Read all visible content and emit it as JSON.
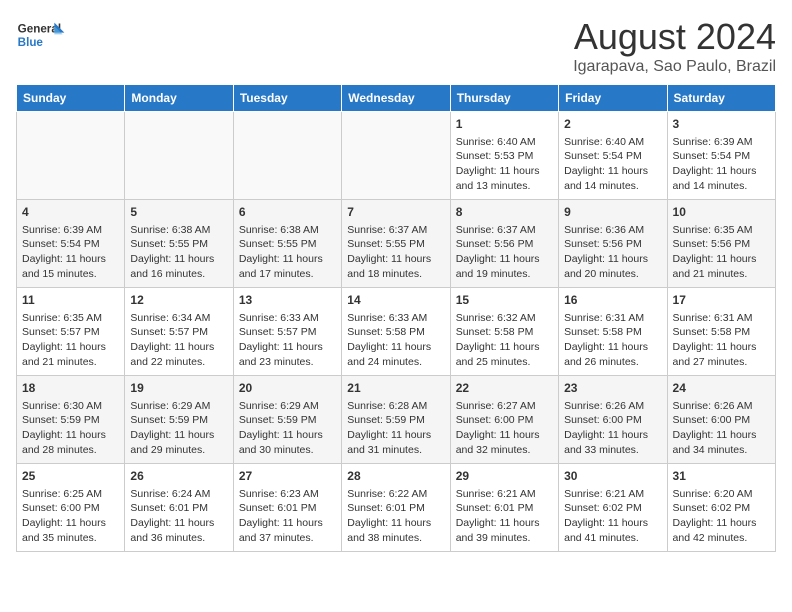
{
  "header": {
    "logo_line1": "General",
    "logo_line2": "Blue",
    "month_year": "August 2024",
    "location": "Igarapava, Sao Paulo, Brazil"
  },
  "columns": [
    "Sunday",
    "Monday",
    "Tuesday",
    "Wednesday",
    "Thursday",
    "Friday",
    "Saturday"
  ],
  "weeks": [
    [
      {
        "day": "",
        "info": ""
      },
      {
        "day": "",
        "info": ""
      },
      {
        "day": "",
        "info": ""
      },
      {
        "day": "",
        "info": ""
      },
      {
        "day": "1",
        "info": "Sunrise: 6:40 AM\nSunset: 5:53 PM\nDaylight: 11 hours and 13 minutes."
      },
      {
        "day": "2",
        "info": "Sunrise: 6:40 AM\nSunset: 5:54 PM\nDaylight: 11 hours and 14 minutes."
      },
      {
        "day": "3",
        "info": "Sunrise: 6:39 AM\nSunset: 5:54 PM\nDaylight: 11 hours and 14 minutes."
      }
    ],
    [
      {
        "day": "4",
        "info": "Sunrise: 6:39 AM\nSunset: 5:54 PM\nDaylight: 11 hours and 15 minutes."
      },
      {
        "day": "5",
        "info": "Sunrise: 6:38 AM\nSunset: 5:55 PM\nDaylight: 11 hours and 16 minutes."
      },
      {
        "day": "6",
        "info": "Sunrise: 6:38 AM\nSunset: 5:55 PM\nDaylight: 11 hours and 17 minutes."
      },
      {
        "day": "7",
        "info": "Sunrise: 6:37 AM\nSunset: 5:55 PM\nDaylight: 11 hours and 18 minutes."
      },
      {
        "day": "8",
        "info": "Sunrise: 6:37 AM\nSunset: 5:56 PM\nDaylight: 11 hours and 19 minutes."
      },
      {
        "day": "9",
        "info": "Sunrise: 6:36 AM\nSunset: 5:56 PM\nDaylight: 11 hours and 20 minutes."
      },
      {
        "day": "10",
        "info": "Sunrise: 6:35 AM\nSunset: 5:56 PM\nDaylight: 11 hours and 21 minutes."
      }
    ],
    [
      {
        "day": "11",
        "info": "Sunrise: 6:35 AM\nSunset: 5:57 PM\nDaylight: 11 hours and 21 minutes."
      },
      {
        "day": "12",
        "info": "Sunrise: 6:34 AM\nSunset: 5:57 PM\nDaylight: 11 hours and 22 minutes."
      },
      {
        "day": "13",
        "info": "Sunrise: 6:33 AM\nSunset: 5:57 PM\nDaylight: 11 hours and 23 minutes."
      },
      {
        "day": "14",
        "info": "Sunrise: 6:33 AM\nSunset: 5:58 PM\nDaylight: 11 hours and 24 minutes."
      },
      {
        "day": "15",
        "info": "Sunrise: 6:32 AM\nSunset: 5:58 PM\nDaylight: 11 hours and 25 minutes."
      },
      {
        "day": "16",
        "info": "Sunrise: 6:31 AM\nSunset: 5:58 PM\nDaylight: 11 hours and 26 minutes."
      },
      {
        "day": "17",
        "info": "Sunrise: 6:31 AM\nSunset: 5:58 PM\nDaylight: 11 hours and 27 minutes."
      }
    ],
    [
      {
        "day": "18",
        "info": "Sunrise: 6:30 AM\nSunset: 5:59 PM\nDaylight: 11 hours and 28 minutes."
      },
      {
        "day": "19",
        "info": "Sunrise: 6:29 AM\nSunset: 5:59 PM\nDaylight: 11 hours and 29 minutes."
      },
      {
        "day": "20",
        "info": "Sunrise: 6:29 AM\nSunset: 5:59 PM\nDaylight: 11 hours and 30 minutes."
      },
      {
        "day": "21",
        "info": "Sunrise: 6:28 AM\nSunset: 5:59 PM\nDaylight: 11 hours and 31 minutes."
      },
      {
        "day": "22",
        "info": "Sunrise: 6:27 AM\nSunset: 6:00 PM\nDaylight: 11 hours and 32 minutes."
      },
      {
        "day": "23",
        "info": "Sunrise: 6:26 AM\nSunset: 6:00 PM\nDaylight: 11 hours and 33 minutes."
      },
      {
        "day": "24",
        "info": "Sunrise: 6:26 AM\nSunset: 6:00 PM\nDaylight: 11 hours and 34 minutes."
      }
    ],
    [
      {
        "day": "25",
        "info": "Sunrise: 6:25 AM\nSunset: 6:00 PM\nDaylight: 11 hours and 35 minutes."
      },
      {
        "day": "26",
        "info": "Sunrise: 6:24 AM\nSunset: 6:01 PM\nDaylight: 11 hours and 36 minutes."
      },
      {
        "day": "27",
        "info": "Sunrise: 6:23 AM\nSunset: 6:01 PM\nDaylight: 11 hours and 37 minutes."
      },
      {
        "day": "28",
        "info": "Sunrise: 6:22 AM\nSunset: 6:01 PM\nDaylight: 11 hours and 38 minutes."
      },
      {
        "day": "29",
        "info": "Sunrise: 6:21 AM\nSunset: 6:01 PM\nDaylight: 11 hours and 39 minutes."
      },
      {
        "day": "30",
        "info": "Sunrise: 6:21 AM\nSunset: 6:02 PM\nDaylight: 11 hours and 41 minutes."
      },
      {
        "day": "31",
        "info": "Sunrise: 6:20 AM\nSunset: 6:02 PM\nDaylight: 11 hours and 42 minutes."
      }
    ]
  ]
}
